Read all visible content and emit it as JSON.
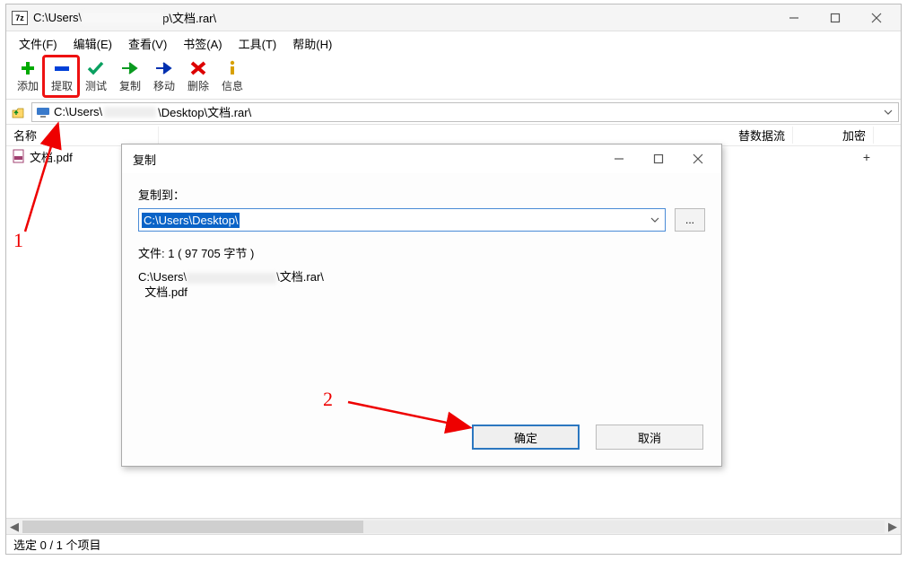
{
  "titlebar": {
    "app_icon_text": "7z",
    "path_prefix": "C:\\Users\\",
    "path_suffix": "p\\文档.rar\\"
  },
  "menubar": {
    "file": "文件(F)",
    "edit": "编辑(E)",
    "view": "查看(V)",
    "bookmarks": "书签(A)",
    "tools": "工具(T)",
    "help": "帮助(H)"
  },
  "toolbar": {
    "add": "添加",
    "extract": "提取",
    "test": "测试",
    "copy": "复制",
    "move": "移动",
    "delete": "删除",
    "info": "信息"
  },
  "addressbar": {
    "path_prefix": "C:\\Users\\",
    "path_suffix": "\\Desktop\\文档.rar\\"
  },
  "columns": {
    "name": "名称",
    "altstream": "替数据流",
    "encrypt": "加密"
  },
  "files": {
    "item0": "文档.pdf",
    "plus": "+"
  },
  "statusbar": {
    "text": "选定 0 / 1 个项目"
  },
  "dialog": {
    "title": "复制",
    "copy_to_label": "复制到：",
    "destination": "C:\\Users\\Desktop\\",
    "browse_label": "...",
    "files_line": "文件: 1   ( 97 705 字节 )",
    "src_prefix": "C:\\Users\\",
    "src_suffix": "\\文档.rar\\",
    "src_file": "文档.pdf",
    "ok": "确定",
    "cancel": "取消"
  },
  "annotations": {
    "one": "1",
    "two": "2"
  }
}
